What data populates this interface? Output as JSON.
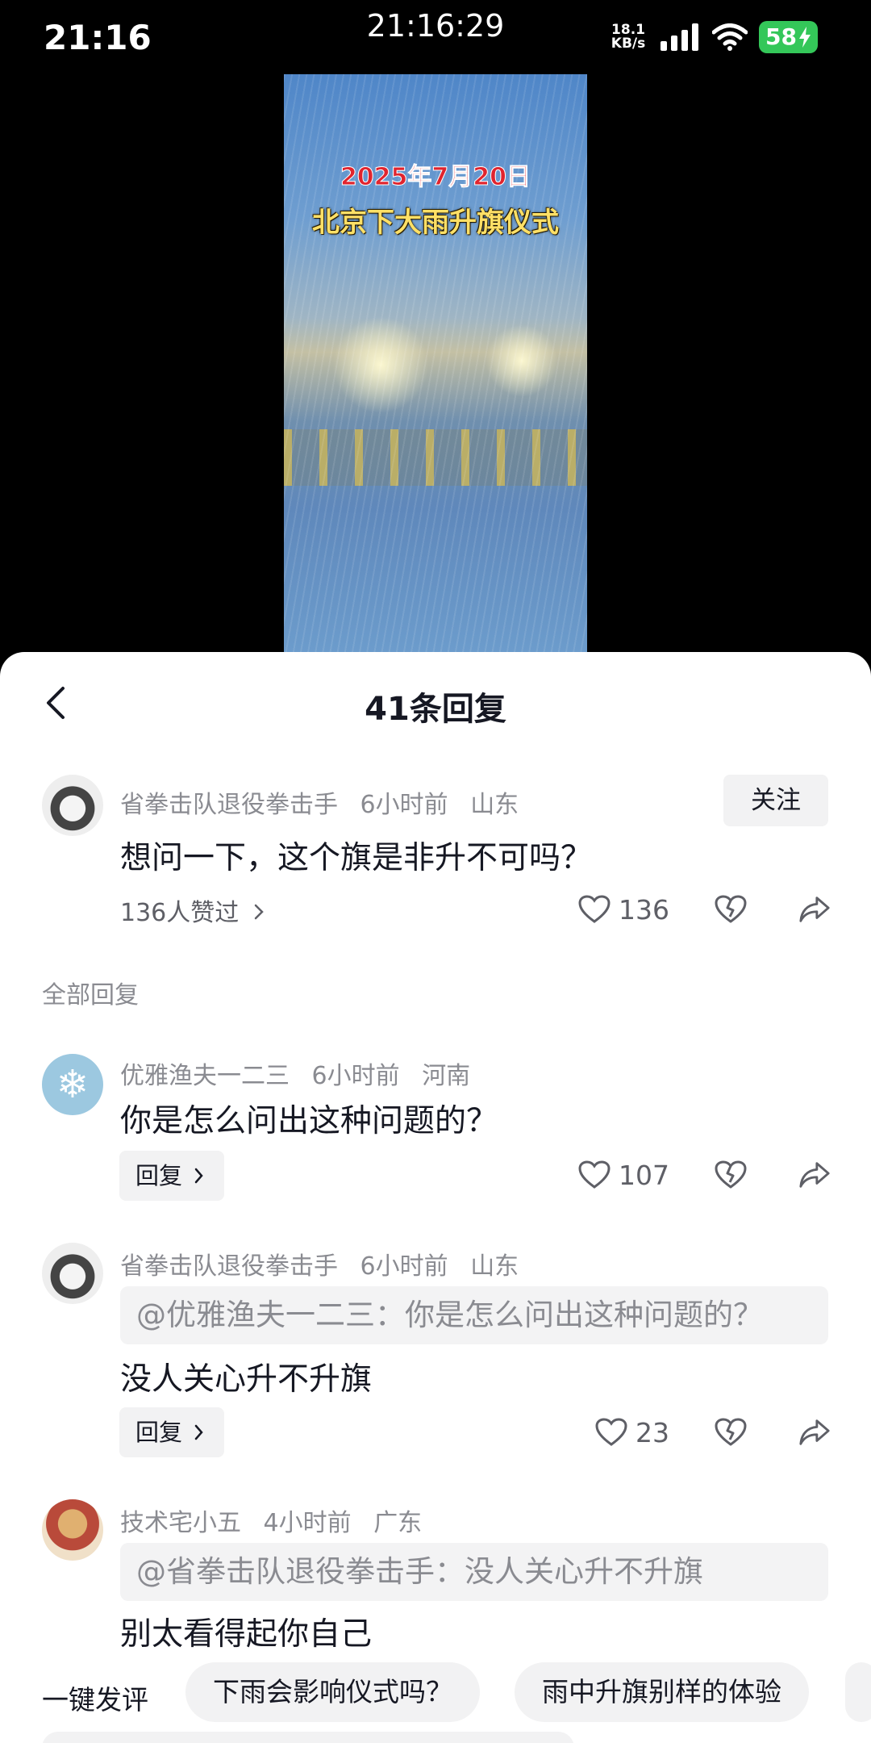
{
  "status_bar": {
    "time": "21:16",
    "center_clock": "21:16:29",
    "net_speed_value": "18.1",
    "net_speed_unit": "KB/s",
    "battery": "58"
  },
  "video": {
    "date_text": "2025年7月20日",
    "title_text": "北京下大雨升旗仪式"
  },
  "sheet": {
    "title": "41条回复",
    "section_label": "全部回复"
  },
  "main_comment": {
    "username": "省拳击队退役拳击手",
    "time": "6小时前",
    "location": "山东",
    "follow_label": "关注",
    "text": "想问一下，这个旗是非升不可吗？",
    "likers": "136人赞过",
    "like_count": "136"
  },
  "replies": [
    {
      "username": "优雅渔夫一二三",
      "time": "6小时前",
      "location": "河南",
      "text": "你是怎么问出这种问题的？",
      "reply_label": "回复",
      "like_count": "107"
    },
    {
      "username": "省拳击队退役拳击手",
      "time": "6小时前",
      "location": "山东",
      "quote": "@优雅渔夫一二三：你是怎么问出这种问题的？",
      "text": "没人关心升不升旗",
      "reply_label": "回复",
      "like_count": "23"
    },
    {
      "username": "技术宅小五",
      "time": "4小时前",
      "location": "广东",
      "quote": "@省拳击队退役拳击手：没人关心升不升旗",
      "text": "别太看得起你自己"
    }
  ],
  "bottom_bar": {
    "quick_label": "一键发评",
    "chips": [
      "下雨会影响仪式吗？",
      "雨中升旗别样的体验"
    ]
  },
  "colors": {
    "battery_green": "#34c759",
    "meta_gray": "#8a8b91",
    "chip_bg": "#f2f2f3"
  }
}
